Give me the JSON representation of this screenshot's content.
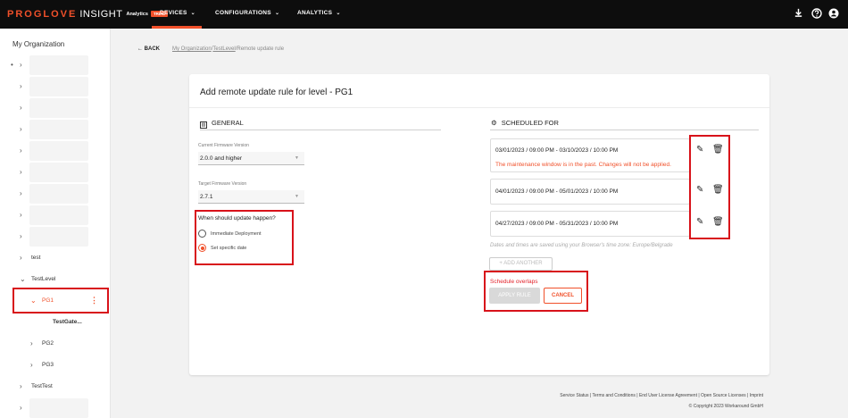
{
  "topbar": {
    "brand": "PROGLOVE",
    "brand_insight": "INSIGHT",
    "brand_analytics": "Analytics",
    "trial_badge": "TRIAL",
    "nav": [
      {
        "label": "DEVICES"
      },
      {
        "label": "CONFIGURATIONS"
      },
      {
        "label": "ANALYTICS"
      }
    ],
    "icons": [
      "download-icon",
      "help-icon",
      "account-icon"
    ]
  },
  "sidebar": {
    "title": "My Organization",
    "items": [
      {
        "label": "test"
      },
      {
        "label": "TestLevel"
      },
      {
        "label": "PG1"
      },
      {
        "label": "TestGate..."
      },
      {
        "label": "PG2"
      },
      {
        "label": "PG3"
      },
      {
        "label": "TestTest"
      }
    ]
  },
  "breadcrumb": {
    "back": "BACK",
    "crumb1": "My Organization",
    "sep1": "/",
    "crumb2": "TestLevel",
    "sep2": "/",
    "current": "Remote update rule"
  },
  "card": {
    "title": "Add remote update rule for level - PG1",
    "general": {
      "heading": "GENERAL",
      "current_label": "Current Firmware Version",
      "current_value": "2.0.0 and higher",
      "target_label": "Target Firmware Version",
      "target_value": "2.7.1",
      "question": "When should update happen?",
      "opt1": "Immediate Deployment",
      "opt2": "Set specific date",
      "selected": "Set specific date"
    },
    "scheduled": {
      "heading": "SCHEDULED FOR",
      "entries": [
        {
          "range": "03/01/2023 / 09:00 PM - 03/10/2023 / 10:00 PM",
          "warning": "The maintenance window is in the past. Changes will not be applied."
        },
        {
          "range": "04/01/2023 / 09:00 PM - 05/01/2023 / 10:00 PM"
        },
        {
          "range": "04/27/2023 / 09:00 PM - 05/31/2023 / 10:00 PM"
        }
      ],
      "note": "Dates and times are saved using your Browser's time zone: Europe/Belgrade",
      "add_label": "+ ADD ANOTHER",
      "overlaps": "Schedule overlaps",
      "apply_label": "APPLY RULE",
      "cancel_label": "CANCEL"
    }
  },
  "footer": {
    "links": "Service Status | Terms and Conditions | End User License Agreement | Open Source Licenses | Imprint",
    "copyright": "© Copyright 2023 Workaround GmbH"
  },
  "colors": {
    "accent": "#f0502a",
    "highlight": "#d8121a",
    "topbar": "#0d0d0d"
  }
}
